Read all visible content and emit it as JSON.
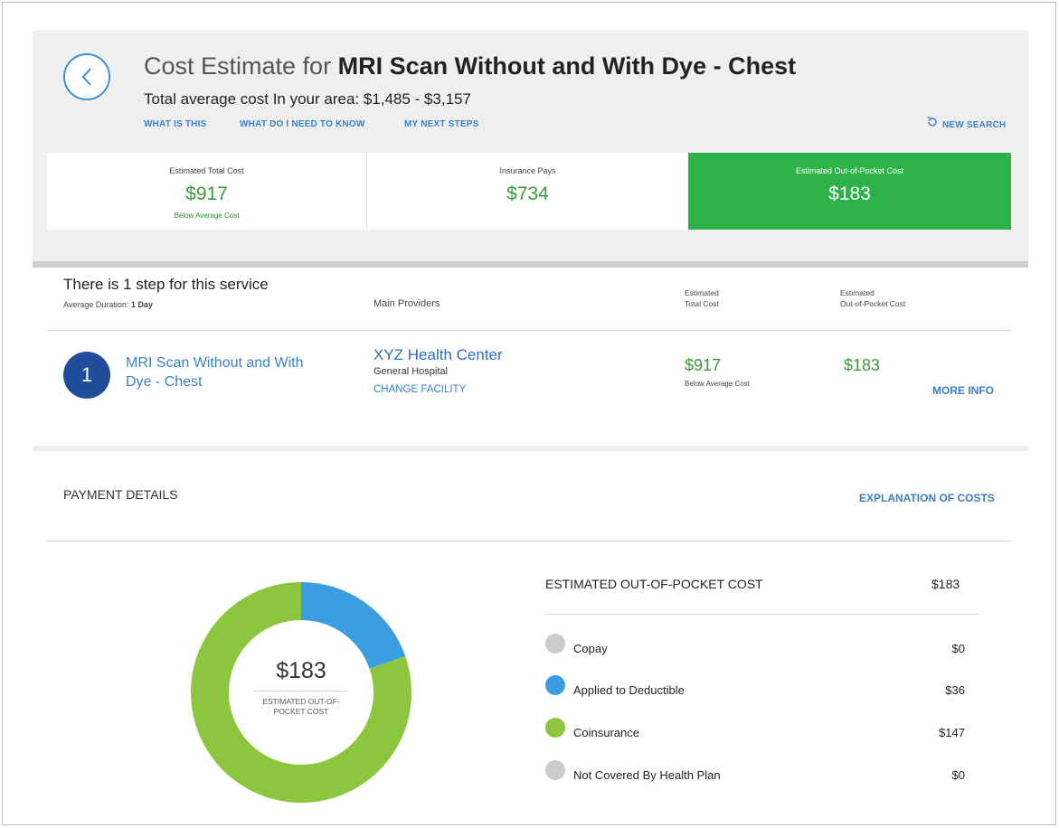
{
  "header": {
    "title_prefix": "Cost Estimate for ",
    "title_service": "MRI Scan Without and With Dye - Chest",
    "subtitle": "Total average cost In your area: $1,485 - $3,157",
    "links": [
      "WHAT IS THIS",
      "WHAT DO I NEED TO KNOW",
      "MY NEXT STEPS"
    ],
    "new_search": "NEW SEARCH"
  },
  "summary_cards": [
    {
      "label": "Estimated Total Cost",
      "value": "$917",
      "note": "Below Average Cost"
    },
    {
      "label": "Insurance Pays",
      "value": "$734"
    },
    {
      "label": "Estimated Out-of-Pocket Cost",
      "value": "$183"
    }
  ],
  "steps_section": {
    "title": "There is 1 step for this service",
    "duration_label": "Average Duration:",
    "duration_value": "1 Day",
    "col_main_providers": "Main Providers",
    "col_total_cost_line1": "Estimated",
    "col_total_cost_line2": "Total Cost",
    "col_oop_line1": "Estimated",
    "col_oop_line2": "Out-of-Pocket Cost"
  },
  "step": {
    "number": "1",
    "service_line1": "MRI Scan Without and With",
    "service_line2": "Dye - Chest",
    "provider_name": "XYZ Health Center",
    "provider_type": "General Hospital",
    "change_facility": "CHANGE FACILITY",
    "total_cost": "$917",
    "total_cost_note": "Below Average Cost",
    "oop_cost": "$183",
    "more_info": "MORE INFO"
  },
  "payment_details": {
    "title": "PAYMENT DETAILS",
    "explanation_link": "EXPLANATION OF COSTS",
    "donut_value": "$183",
    "donut_label": "ESTIMATED OUT-OF-POCKET COST",
    "oop_title": "ESTIMATED OUT-OF-POCKET COST",
    "oop_value": "$183",
    "items": [
      {
        "label": "Copay",
        "value": "$0",
        "amount": 0,
        "color": "#cccccc"
      },
      {
        "label": "Applied to Deductible",
        "value": "$36",
        "amount": 36,
        "color": "#3b9de0"
      },
      {
        "label": "Coinsurance",
        "value": "$147",
        "amount": 147,
        "color": "#8cc63f"
      },
      {
        "label": "Not Covered By Health Plan",
        "value": "$0",
        "amount": 0,
        "color": "#cccccc"
      }
    ]
  },
  "colors": {
    "accent_blue": "#3a7fc8",
    "step_circle": "#1f4d9a",
    "oop_card_green": "#2db34a",
    "value_green": "#3a9a3a"
  }
}
